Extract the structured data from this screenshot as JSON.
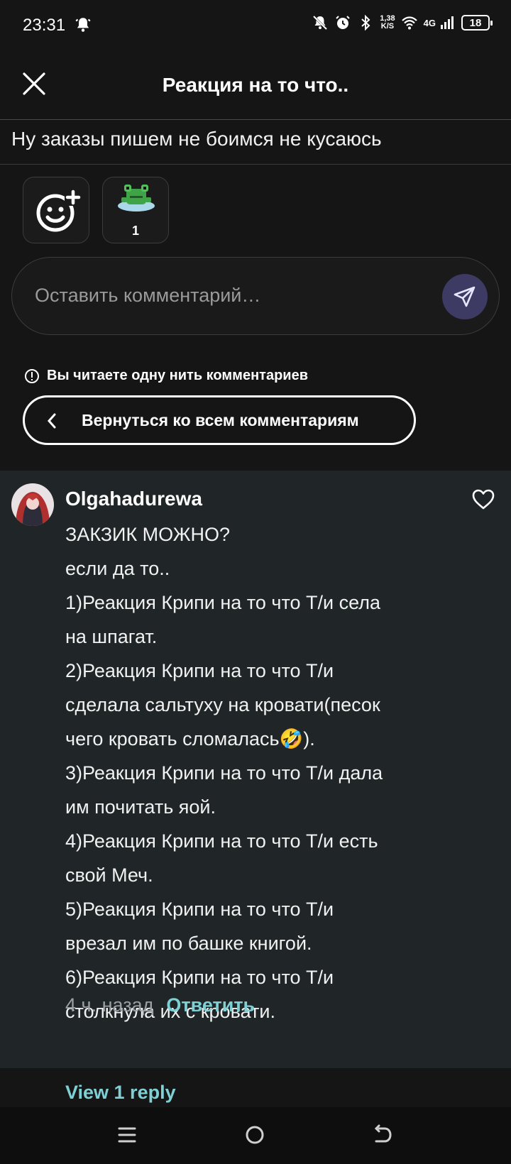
{
  "status": {
    "time": "23:31",
    "net_speed": "1,38",
    "net_unit": "K/S",
    "network": "4G",
    "battery": "18"
  },
  "header": {
    "title": "Реакция на то что.."
  },
  "post": {
    "text": "Ну заказы пишем не боимся не кусаюсь"
  },
  "reactions": {
    "frog_count": "1"
  },
  "comment_input": {
    "placeholder": "Оставить комментарий…"
  },
  "thread": {
    "info": "Вы читаете одну нить комментариев",
    "back_label": "Вернуться ко всем комментариям"
  },
  "comment": {
    "author": "Olgahadurewa",
    "lines": [
      "ЗАКЗИК МОЖНО?",
      "если да то..",
      "1)Реакция Крипи на то что Т/и села",
      "на шпагат.",
      "2)Реакция Крипи на то что Т/и",
      "сделала сальтуху на кровати(песок",
      "чего кровать сломалась🤣).",
      "3)Реакция Крипи на то что Т/и дала",
      "им почитать яой.",
      "4)Реакция Крипи на то что Т/и есть",
      "свой Меч.",
      "5)Реакция Крипи на то что Т/и",
      "врезал им по башке книгой.",
      "6)Реакция Крипи на то что Т/и",
      "столкнула их с кровати."
    ],
    "time_ago": "4 ч. назад",
    "reply_label": "Ответить"
  },
  "view_replies": "View 1 reply",
  "colors": {
    "background": "#151515",
    "comment_card": "#202628",
    "accent_link": "#7fd0d4",
    "send_button": "#3d3a63"
  }
}
